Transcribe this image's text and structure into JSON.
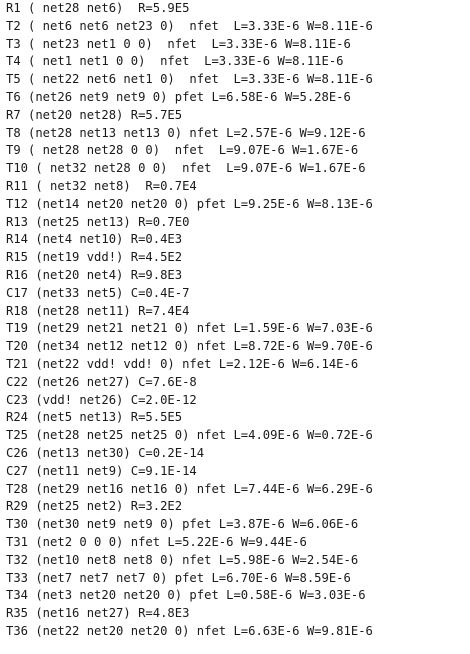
{
  "lines": [
    "R1 ( net28 net6)  R=5.9E5",
    "T2 ( net6 net6 net23 0)  nfet  L=3.33E-6 W=8.11E-6",
    "T3 ( net23 net1 0 0)  nfet  L=3.33E-6 W=8.11E-6",
    "T4 ( net1 net1 0 0)  nfet  L=3.33E-6 W=8.11E-6",
    "T5 ( net22 net6 net1 0)  nfet  L=3.33E-6 W=8.11E-6",
    "T6 (net26 net9 net9 0) pfet L=6.58E-6 W=5.28E-6",
    "R7 (net20 net28) R=5.7E5",
    "T8 (net28 net13 net13 0) nfet L=2.57E-6 W=9.12E-6",
    "T9 ( net28 net28 0 0)  nfet  L=9.07E-6 W=1.67E-6",
    "T10 ( net32 net28 0 0)  nfet  L=9.07E-6 W=1.67E-6",
    "R11 ( net32 net8)  R=0.7E4",
    "T12 (net14 net20 net20 0) pfet L=9.25E-6 W=8.13E-6",
    "R13 (net25 net13) R=0.7E0",
    "R14 (net4 net10) R=0.4E3",
    "R15 (net19 vdd!) R=4.5E2",
    "R16 (net20 net4) R=9.8E3",
    "C17 (net33 net5) C=0.4E-7",
    "R18 (net28 net11) R=7.4E4",
    "T19 (net29 net21 net21 0) nfet L=1.59E-6 W=7.03E-6",
    "T20 (net34 net12 net12 0) nfet L=8.72E-6 W=9.70E-6",
    "T21 (net22 vdd! vdd! 0) nfet L=2.12E-6 W=6.14E-6",
    "C22 (net26 net27) C=7.6E-8",
    "C23 (vdd! net26) C=2.0E-12",
    "R24 (net5 net13) R=5.5E5",
    "T25 (net28 net25 net25 0) nfet L=4.09E-6 W=0.72E-6",
    "C26 (net13 net30) C=0.2E-14",
    "C27 (net11 net9) C=9.1E-14",
    "T28 (net29 net16 net16 0) nfet L=7.44E-6 W=6.29E-6",
    "R29 (net25 net2) R=3.2E2",
    "T30 (net30 net9 net9 0) pfet L=3.87E-6 W=6.06E-6",
    "T31 (net2 0 0 0) nfet L=5.22E-6 W=9.44E-6",
    "T32 (net10 net8 net8 0) nfet L=5.98E-6 W=2.54E-6",
    "T33 (net7 net7 net7 0) pfet L=6.70E-6 W=8.59E-6",
    "T34 (net3 net20 net20 0) pfet L=0.58E-6 W=3.03E-6",
    "R35 (net16 net27) R=4.8E3",
    "T36 (net22 net20 net20 0) nfet L=6.63E-6 W=9.81E-6"
  ]
}
